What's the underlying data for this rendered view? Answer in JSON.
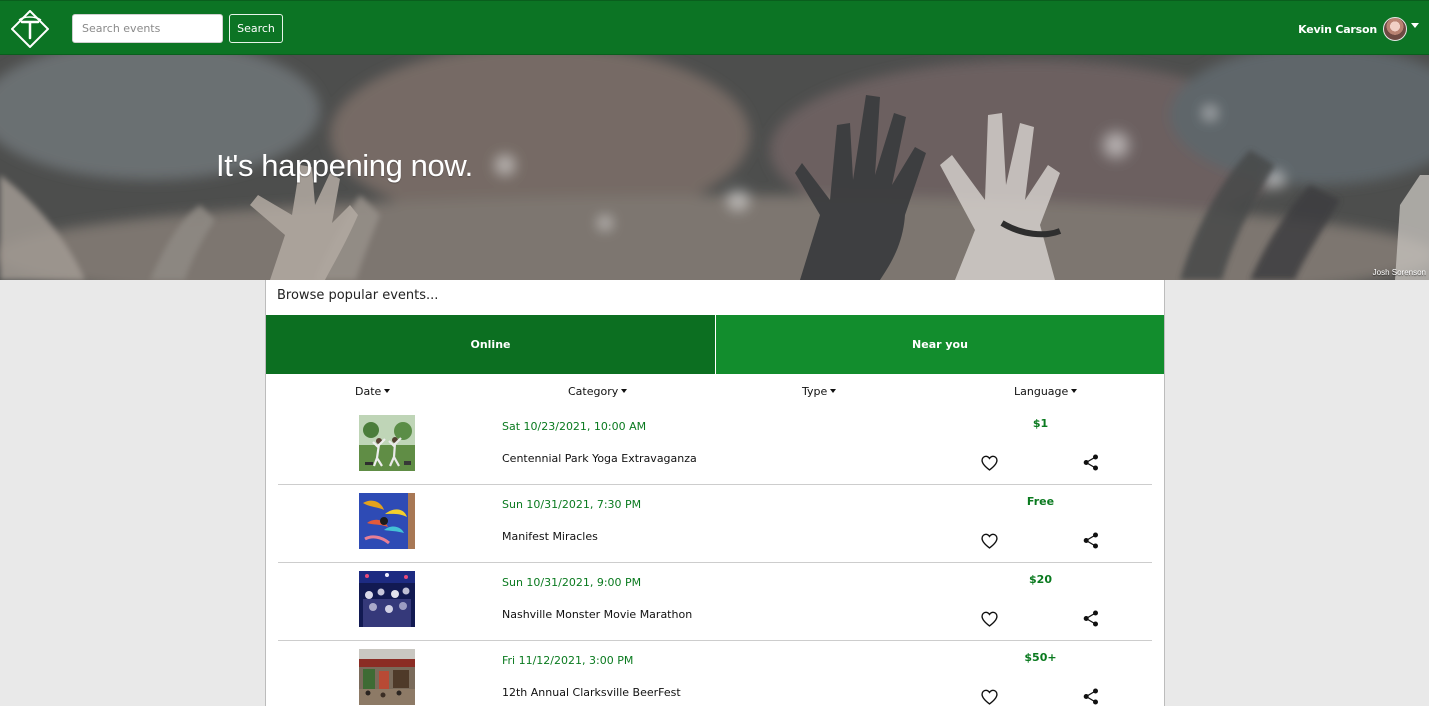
{
  "navbar": {
    "logo": "triangle-t-logo",
    "search": {
      "placeholder": "Search events",
      "value": ""
    },
    "search_button": "Search",
    "user": {
      "name": "Kevin Carson",
      "avatar": "avatar"
    }
  },
  "hero": {
    "title": "It's happening now.",
    "credit": "Josh Sorenson"
  },
  "browse": {
    "heading": "Browse popular events...",
    "tabs": [
      {
        "label": "Online",
        "active": true
      },
      {
        "label": "Near you",
        "active": false
      }
    ],
    "filters": [
      {
        "label": "Date"
      },
      {
        "label": "Category"
      },
      {
        "label": "Type"
      },
      {
        "label": "Language"
      }
    ],
    "events": [
      {
        "date": "Sat 10/23/2021, 10:00 AM",
        "title": "Centennial Park Yoga Extravaganza",
        "price": "$1",
        "thumb": "yoga-thumbnail"
      },
      {
        "date": "Sun 10/31/2021, 7:30 PM",
        "title": "Manifest Miracles",
        "price": "Free",
        "thumb": "art-thumbnail"
      },
      {
        "date": "Sun 10/31/2021, 9:00 PM",
        "title": "Nashville Monster Movie Marathon",
        "price": "$20",
        "thumb": "crowd-thumbnail"
      },
      {
        "date": "Fri 11/12/2021, 3:00 PM",
        "title": "12th Annual Clarksville BeerFest",
        "price": "$50+",
        "thumb": "festival-thumbnail"
      }
    ]
  },
  "colors": {
    "navbar": "#0c7424",
    "tab_active": "#0c6f21",
    "tab_inactive": "#128d2d",
    "accent_text": "#0a7a1f"
  },
  "icons": [
    "heart-icon",
    "share-icon",
    "chevron-down-icon"
  ]
}
